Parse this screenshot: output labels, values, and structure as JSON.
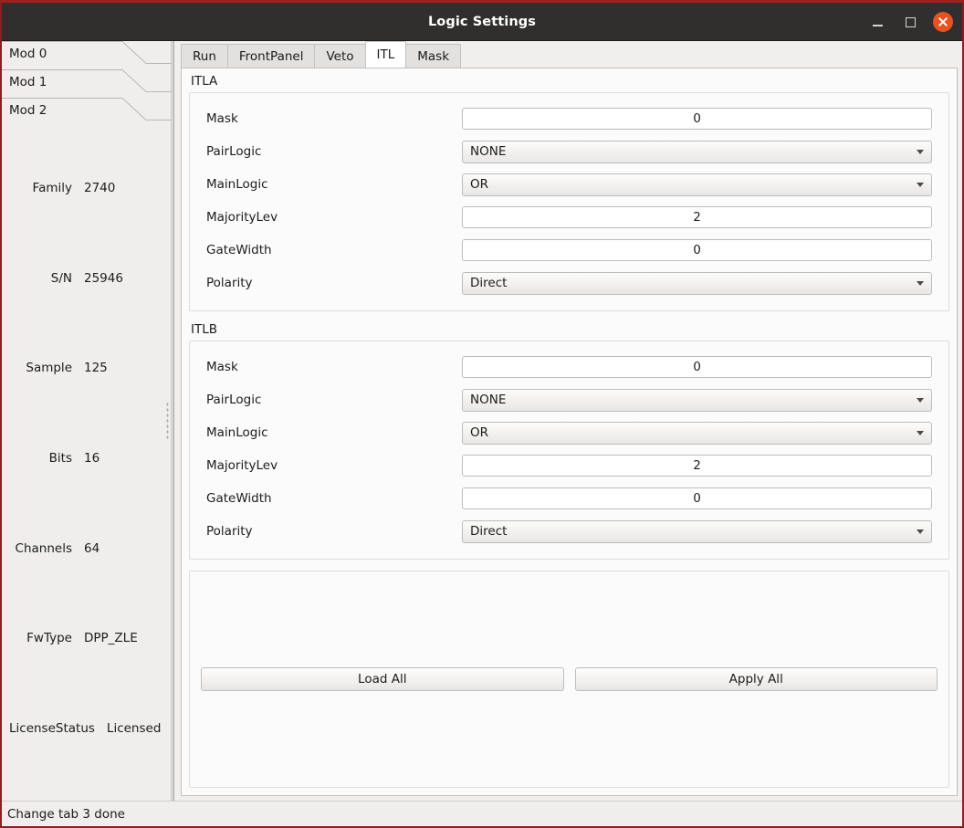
{
  "window": {
    "title": "Logic Settings",
    "controls": {
      "minimize": "minimize",
      "maximize": "maximize",
      "close": "close"
    },
    "accent_close_color": "#e8521f",
    "titlebar_color": "#302f2d",
    "border_color": "#8c1f1f"
  },
  "sidebar": {
    "mod_tabs": [
      {
        "label": "Mod 0"
      },
      {
        "label": "Mod 1"
      },
      {
        "label": "Mod 2"
      }
    ],
    "properties": [
      {
        "key": "Family",
        "value": "2740"
      },
      {
        "key": "S/N",
        "value": "25946"
      },
      {
        "key": "Sample",
        "value": "125"
      },
      {
        "key": "Bits",
        "value": "16"
      },
      {
        "key": "Channels",
        "value": "64"
      },
      {
        "key": "FwType",
        "value": "DPP_ZLE"
      },
      {
        "key": "LicenseStatus",
        "value": "Licensed"
      }
    ]
  },
  "tabs": [
    {
      "label": "Run",
      "selected": false
    },
    {
      "label": "FrontPanel",
      "selected": false
    },
    {
      "label": "Veto",
      "selected": false
    },
    {
      "label": "ITL",
      "selected": true
    },
    {
      "label": "Mask",
      "selected": false
    }
  ],
  "groups": [
    {
      "title": "ITLA",
      "fields": [
        {
          "label": "Mask",
          "type": "lineedit",
          "value": "0"
        },
        {
          "label": "PairLogic",
          "type": "combobox",
          "value": "NONE"
        },
        {
          "label": "MainLogic",
          "type": "combobox",
          "value": "OR"
        },
        {
          "label": "MajorityLev",
          "type": "lineedit",
          "value": "2"
        },
        {
          "label": "GateWidth",
          "type": "lineedit",
          "value": "0"
        },
        {
          "label": "Polarity",
          "type": "combobox",
          "value": "Direct"
        }
      ]
    },
    {
      "title": "ITLB",
      "fields": [
        {
          "label": "Mask",
          "type": "lineedit",
          "value": "0"
        },
        {
          "label": "PairLogic",
          "type": "combobox",
          "value": "NONE"
        },
        {
          "label": "MainLogic",
          "type": "combobox",
          "value": "OR"
        },
        {
          "label": "MajorityLev",
          "type": "lineedit",
          "value": "2"
        },
        {
          "label": "GateWidth",
          "type": "lineedit",
          "value": "0"
        },
        {
          "label": "Polarity",
          "type": "combobox",
          "value": "Direct"
        }
      ]
    }
  ],
  "actions": {
    "load_all_label": "Load All",
    "apply_all_label": "Apply All"
  },
  "statusbar": {
    "message": "Change tab 3 done"
  }
}
